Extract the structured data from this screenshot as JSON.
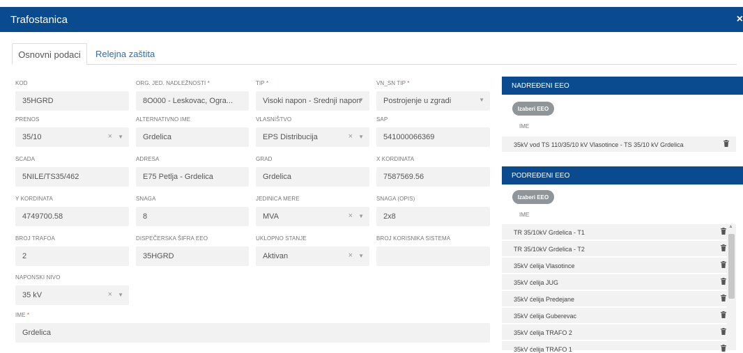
{
  "window": {
    "title": "Trafostanica",
    "close_label": "×"
  },
  "tabs": [
    {
      "label": "Osnovni podaci"
    },
    {
      "label": "Relejna zaštita"
    }
  ],
  "fields": {
    "kod": {
      "label": "KOD",
      "value": "35HGRD"
    },
    "org": {
      "label": "ORG. JED. NADLEŽNOSTI",
      "value": "8O000 - Leskovac, Ogra..."
    },
    "tip": {
      "label": "TIP",
      "value": "Visoki napon - Srednji napon"
    },
    "vnsn": {
      "label": "VN_SN TIP",
      "value": "Postrojenje u zgradi"
    },
    "prenos": {
      "label": "PRENOS",
      "value": "35/10"
    },
    "alt": {
      "label": "ALTERNATIVNO IME",
      "value": "Grdelica"
    },
    "vlasnistvo": {
      "label": "VLASNIŠTVO",
      "value": "EPS Distribucija"
    },
    "sap": {
      "label": "SAP",
      "value": "541000066369"
    },
    "scada": {
      "label": "SCADA",
      "value": "5NILE/TS35/462"
    },
    "adresa": {
      "label": "ADRESA",
      "value": "E75 Petlja - Grdelica"
    },
    "grad": {
      "label": "GRAD",
      "value": "Grdelica"
    },
    "xk": {
      "label": "X KORDINATA",
      "value": "7587569.56"
    },
    "yk": {
      "label": "Y KORDINATA",
      "value": "4749700.58"
    },
    "snaga": {
      "label": "SNAGA",
      "value": "8"
    },
    "jedinica": {
      "label": "JEDINICA MERE",
      "value": "MVA"
    },
    "snaga_opis": {
      "label": "SNAGA (OPIS)",
      "value": "2x8"
    },
    "broj_trafoa": {
      "label": "BROJ TRAFOA",
      "value": "2"
    },
    "disp": {
      "label": "DISPEČERSKA ŠIFRA EEO",
      "value": "35HGRD"
    },
    "uklopno": {
      "label": "UKLOPNO STANJE",
      "value": "Aktivan"
    },
    "broj_kor": {
      "label": "BROJ KORISNIKA SISTEMA",
      "value": ""
    },
    "napon": {
      "label": "NAPONSKI NIVO",
      "value": "35 kV"
    },
    "ime": {
      "label": "IME",
      "value": "Grdelica"
    }
  },
  "required_mark": "*",
  "clear_glyph": "×",
  "caret_glyph": "▼",
  "nadredeni": {
    "header": "NADREĐENI EEO",
    "button": "Izaberi EEO",
    "col": "IME",
    "rows": [
      "35kV vod TS 110/35/10 kV Vlasotince - TS 35/10 kV Grdelica"
    ]
  },
  "podredeni": {
    "header": "PODREĐENI EEO",
    "button": "Izaberi EEO",
    "col": "IME",
    "rows": [
      "TR 35/10kV Grdelica - T1",
      "TR 35/10kV Grdelica - T2",
      "35kV ćelija Vlasotince",
      "35kV ćelija JUG",
      "35kV ćelija Predejane",
      "35kV ćelija Guberevac",
      "35kV ćelija TRAFO 2",
      "35kV ćelija TRAFO 1"
    ]
  },
  "colors": {
    "header": "#0a4a8f",
    "field_bg": "#f2f2f2",
    "required": "#d9534f",
    "link": "#2a6ebb"
  }
}
